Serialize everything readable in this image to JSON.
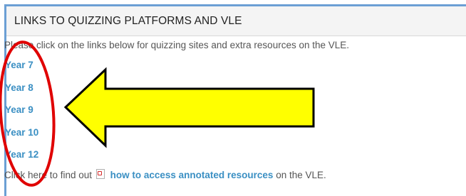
{
  "panel": {
    "title": "LINKS TO QUIZZING PLATFORMS AND VLE",
    "intro": "Please click on the links below for quizzing sites and extra resources on the VLE."
  },
  "year_links": [
    {
      "label": "Year 7"
    },
    {
      "label": "Year 8"
    },
    {
      "label": "Year 9"
    },
    {
      "label": "Year 10"
    },
    {
      "label": "Year 12"
    }
  ],
  "footer": {
    "prefix": "Click here to find out",
    "icon": "pdf-icon",
    "link": "how to access annotated resources",
    "suffix": "on the VLE."
  },
  "annotations": {
    "arrow_color": "#ffff00",
    "ellipse_color": "#e00000",
    "outline_color": "#000000"
  },
  "colors": {
    "link": "#3a8fc3",
    "panel_border": "#6b9fd4",
    "header_bg": "#f4f4f4"
  }
}
